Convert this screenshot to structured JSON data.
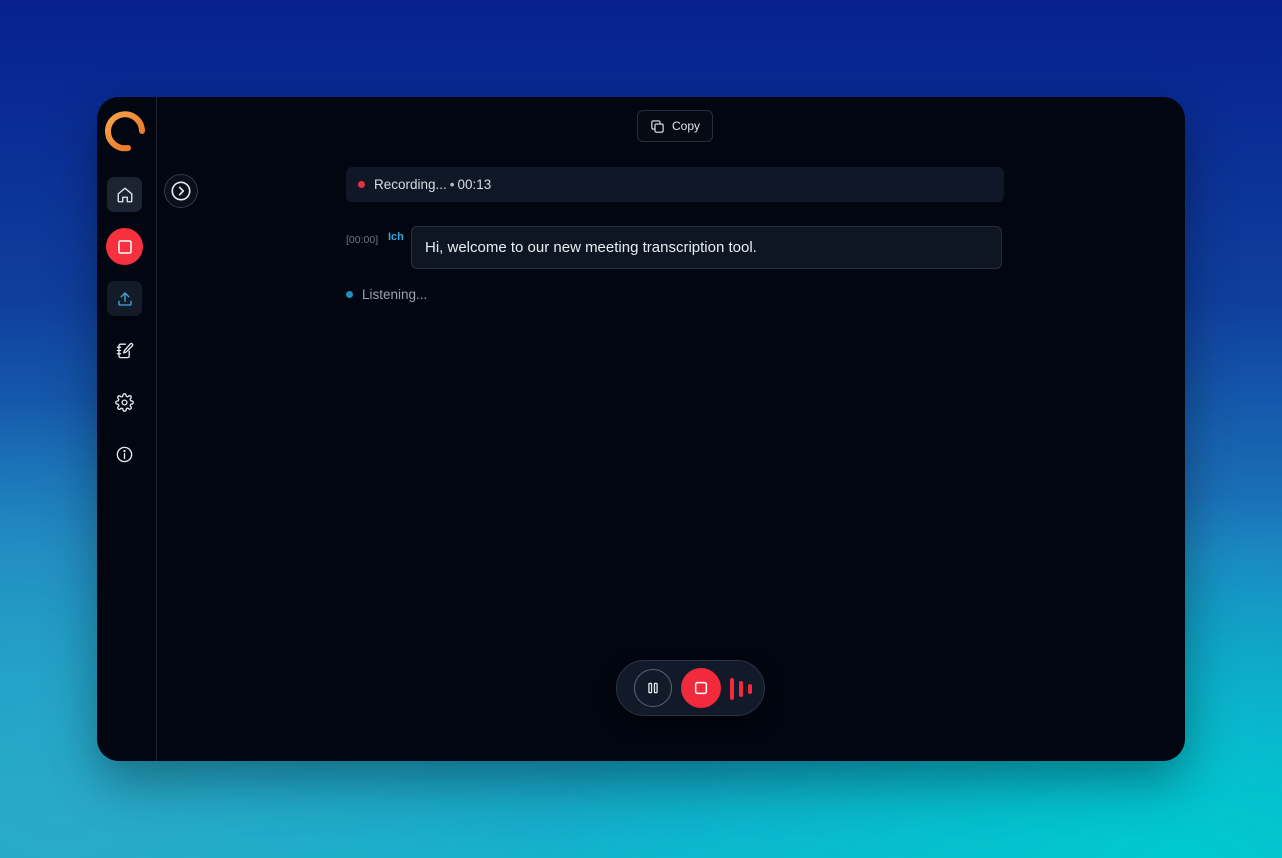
{
  "toolbar": {
    "copy_label": "Copy"
  },
  "status": {
    "label": "Recording...",
    "separator": "•",
    "elapsed": "00:13"
  },
  "transcript": [
    {
      "timestamp": "[00:00]",
      "speaker": "Ich",
      "text": "Hi, welcome to our new meeting transcription tool."
    }
  ],
  "listening": {
    "label": "Listening..."
  },
  "sidebar": {
    "items": [
      {
        "icon": "home-icon"
      },
      {
        "icon": "record-stop-icon"
      },
      {
        "icon": "upload-icon"
      },
      {
        "icon": "notebook-edit-icon"
      },
      {
        "icon": "gear-icon"
      },
      {
        "icon": "info-icon"
      }
    ]
  },
  "colors": {
    "accent_red": "#f22a3c",
    "accent_blue": "#34a6da",
    "logo_orange": "#f08a32",
    "window_bg": "#020610"
  }
}
